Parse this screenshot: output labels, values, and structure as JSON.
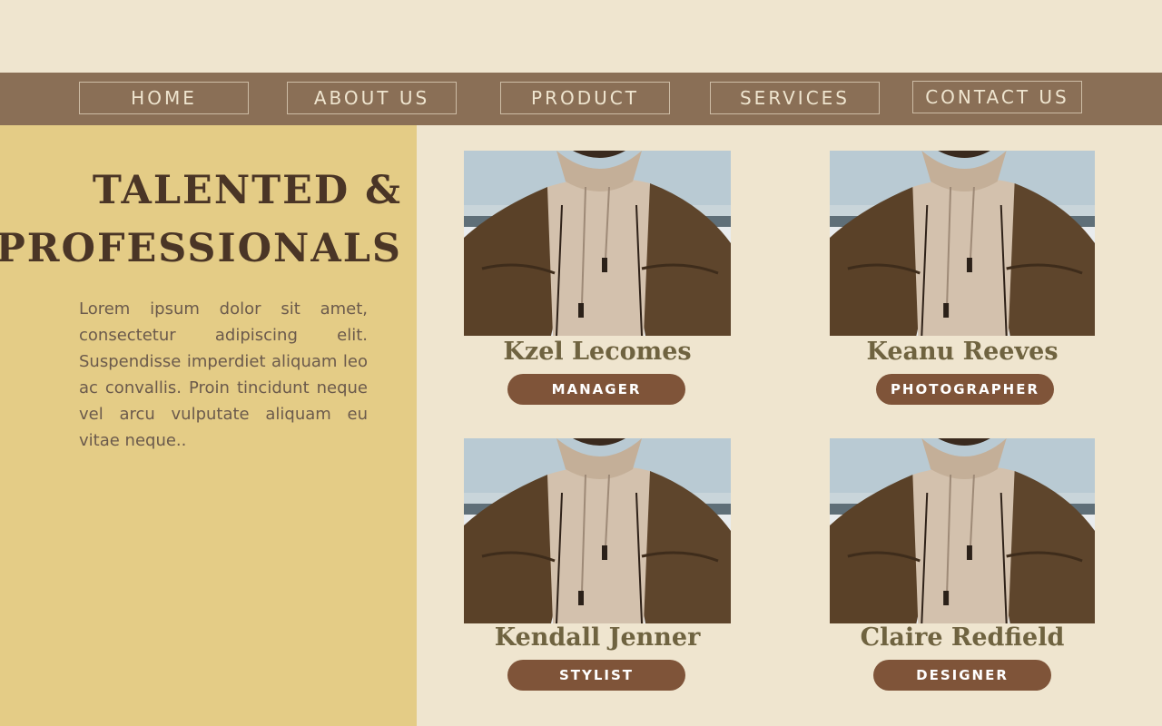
{
  "nav": {
    "items": [
      {
        "label": "HOME"
      },
      {
        "label": "ABOUT US"
      },
      {
        "label": "PRODUCT"
      },
      {
        "label": "SERVICES"
      },
      {
        "label": "CONTACT US"
      }
    ]
  },
  "intro": {
    "headline_line1": "TALENTED &",
    "headline_line2": "PROFESSIONALS",
    "body": "Lorem ipsum dolor sit amet, consectetur adipiscing elit. Suspendisse imperdiet aliquam leo ac convallis. Proin tincidunt neque vel arcu vulputate aliquam eu vitae neque.."
  },
  "team": [
    {
      "name": "Kzel Lecomes",
      "role": "MANAGER"
    },
    {
      "name": "Keanu Reeves",
      "role": "PHOTOGRAPHER"
    },
    {
      "name": "Kendall Jenner",
      "role": "STYLIST"
    },
    {
      "name": "Claire Redfield",
      "role": "DESIGNER"
    }
  ],
  "colors": {
    "background": "#efe5cf",
    "nav_bar": "#8a6f56",
    "left_panel": "#e4cc86",
    "heading": "#4a3526",
    "name": "#6f6340",
    "pill": "#7f5439"
  }
}
